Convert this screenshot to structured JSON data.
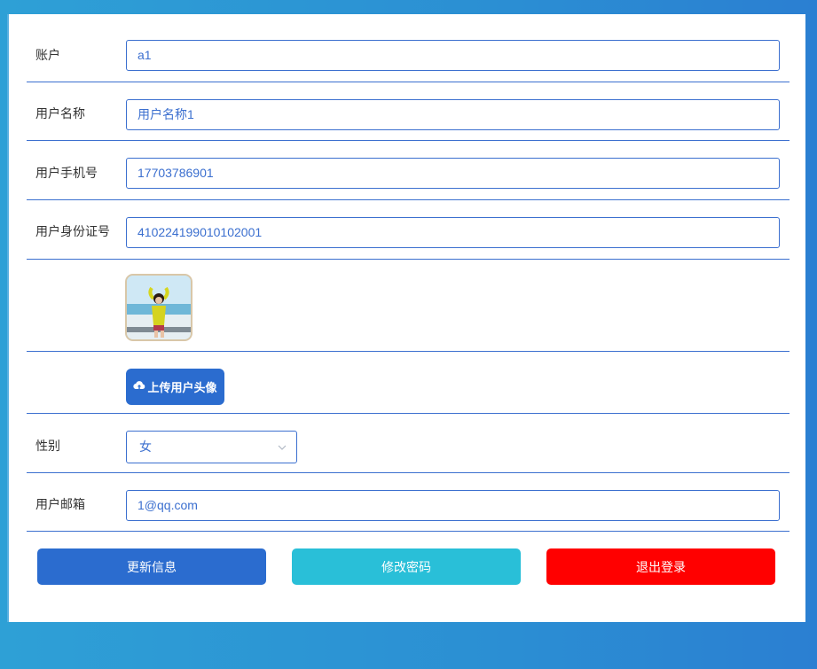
{
  "fields": {
    "account": {
      "label": "账户",
      "value": "a1"
    },
    "username": {
      "label": "用户名称",
      "value": "用户名称1"
    },
    "phone": {
      "label": "用户手机号",
      "value": "17703786901"
    },
    "id_number": {
      "label": "用户身份证号",
      "value": "410224199010102001"
    },
    "gender": {
      "label": "性别",
      "value": "女"
    },
    "email": {
      "label": "用户邮箱",
      "value": "1@qq.com"
    }
  },
  "upload_avatar_label": "上传用户头像",
  "buttons": {
    "update": "更新信息",
    "change_password": "修改密码",
    "logout": "退出登录"
  },
  "colors": {
    "accent_blue": "#2b6ccf",
    "cyan": "#29bfd8",
    "red": "#ff0000"
  }
}
